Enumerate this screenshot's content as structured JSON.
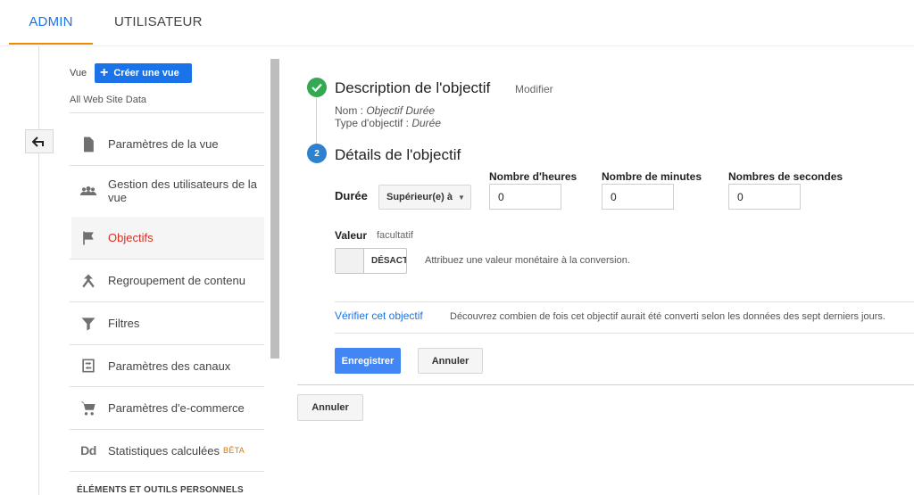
{
  "tabs": {
    "admin": "ADMIN",
    "user": "UTILISATEUR"
  },
  "sidebar": {
    "view_label": "Vue",
    "create_view": "Créer une vue",
    "view_name": "All Web Site Data",
    "items": [
      {
        "label": "Paramètres de la vue",
        "icon": "document-icon"
      },
      {
        "label": "Gestion des utilisateurs de la vue",
        "icon": "users-icon"
      },
      {
        "label": "Objectifs",
        "icon": "flag-icon",
        "active": true
      },
      {
        "label": "Regroupement de contenu",
        "icon": "merge-icon"
      },
      {
        "label": "Filtres",
        "icon": "filter-icon"
      },
      {
        "label": "Paramètres des canaux",
        "icon": "channels-icon"
      },
      {
        "label": "Paramètres d'e-commerce",
        "icon": "cart-icon"
      },
      {
        "label": "Statistiques calculées",
        "icon": "dd-icon",
        "badge": "BÊTA",
        "icon_text": "Dd"
      }
    ],
    "section": "ÉLÉMENTS ET OUTILS PERSONNELS"
  },
  "step1": {
    "title": "Description de l'objectif",
    "modify": "Modifier",
    "name_label": "Nom : ",
    "name_value": "Objectif Durée",
    "type_label": "Type d'objectif : ",
    "type_value": "Durée"
  },
  "step2": {
    "number": "2",
    "title": "Détails de l'objectif",
    "duration_label": "Durée",
    "comparison": "Supérieur(e) à",
    "hours_label": "Nombre d'heures",
    "minutes_label": "Nombre de minutes",
    "seconds_label": "Nombres de secondes",
    "hours_value": "0",
    "minutes_value": "0",
    "seconds_value": "0",
    "value_label": "Valeur",
    "value_optional": "facultatif",
    "toggle_label": "DÉSACT",
    "value_hint": "Attribuez une valeur monétaire à la conversion.",
    "verify_link": "Vérifier cet objectif",
    "verify_hint": "Découvrez combien de fois cet objectif aurait été converti selon les données des sept derniers jours."
  },
  "buttons": {
    "save": "Enregistrer",
    "cancel_inner": "Annuler",
    "cancel_outer": "Annuler"
  },
  "colors": {
    "accent": "#1a73e8",
    "active_tab_underline": "#f08b00",
    "active_item": "#d93025",
    "success": "#34a853",
    "step": "#2d82cf"
  }
}
